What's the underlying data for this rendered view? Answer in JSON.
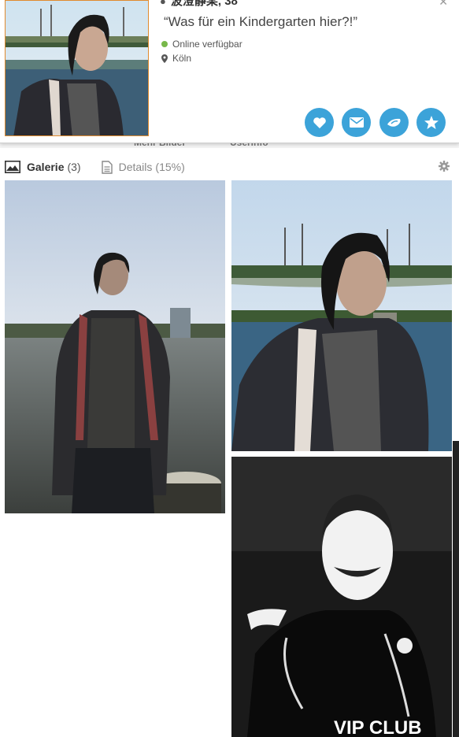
{
  "profile": {
    "name_age": "波澄靜某, 38",
    "quote": "“Was für ein Kindergarten hier?!”",
    "status": "Online verfügbar",
    "location": "Köln",
    "status_color": "#78b84a",
    "accent_color": "#3ca3d9"
  },
  "actions": [
    {
      "icon": "heart-icon"
    },
    {
      "icon": "envelope-icon"
    },
    {
      "icon": "wink-icon"
    },
    {
      "icon": "star-icon"
    }
  ],
  "menu_strip": {
    "item_1": "Mehr Bilder",
    "item_2": "Userinfo"
  },
  "tabs": {
    "gallery_label": "Galerie",
    "gallery_count": "(3)",
    "details_label": "Details",
    "details_count": "(15%)"
  },
  "gallery": [
    {
      "desc": "Mann am Rheinufer"
    },
    {
      "desc": "Mann vor Brücke"
    },
    {
      "desc": "Schwarzweiß-Foto"
    }
  ],
  "photo_3_text": "VIP CLUB"
}
